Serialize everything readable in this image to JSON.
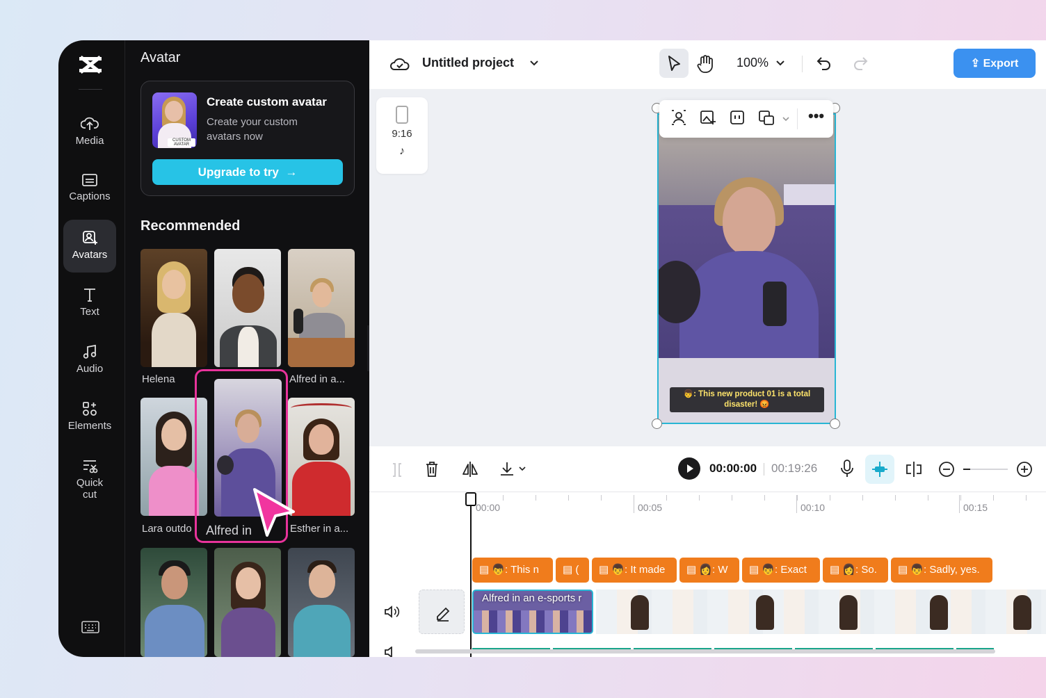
{
  "rail": {
    "items": [
      {
        "label": "Media",
        "icon": "cloud-upload-icon"
      },
      {
        "label": "Captions",
        "icon": "captions-icon"
      },
      {
        "label": "Avatars",
        "icon": "avatar-icon"
      },
      {
        "label": "Text",
        "icon": "text-icon"
      },
      {
        "label": "Audio",
        "icon": "music-icon"
      },
      {
        "label": "Elements",
        "icon": "elements-icon"
      },
      {
        "label": "Quick",
        "label2": "cut",
        "icon": "quick-cut-icon"
      }
    ],
    "active": "Avatars"
  },
  "panel": {
    "title": "Avatar",
    "promo": {
      "title": "Create custom avatar",
      "subtitle": "Create your custom avatars now",
      "thumb_tag": "CUSTOM AVATAR",
      "button": "Upgrade to try"
    },
    "section": "Recommended",
    "avatars": [
      {
        "caption": "Helena"
      },
      {
        "caption": ""
      },
      {
        "caption": "Alfred in a..."
      },
      {
        "caption": "Lara outdo"
      },
      {
        "caption": "Alfred in",
        "selected": true
      },
      {
        "caption": "Esther in a..."
      },
      {
        "caption": ""
      },
      {
        "caption": ""
      },
      {
        "caption": ""
      }
    ]
  },
  "header": {
    "project_title": "Untitled project",
    "zoom": "100%",
    "export_label": "Export"
  },
  "canvas": {
    "ratio": "9:16",
    "subtitle_line1": "👦: This new product 01 is a total",
    "subtitle_line2": "disaster! 😡"
  },
  "timeline": {
    "current_time": "00:00:00",
    "total_time": "00:19:26",
    "ruler": [
      "00:00",
      "00:05",
      "00:10",
      "00:15"
    ],
    "caption_clips": [
      "👦: This n",
      "(",
      "👦: It made",
      "👩: W",
      "👦: Exact",
      "👩: So.",
      "👦: Sadly, yes."
    ],
    "video_clip_label": "Alfred in an e-sports r",
    "accent": "#28b6d4",
    "caption_color": "#f07c1c"
  }
}
